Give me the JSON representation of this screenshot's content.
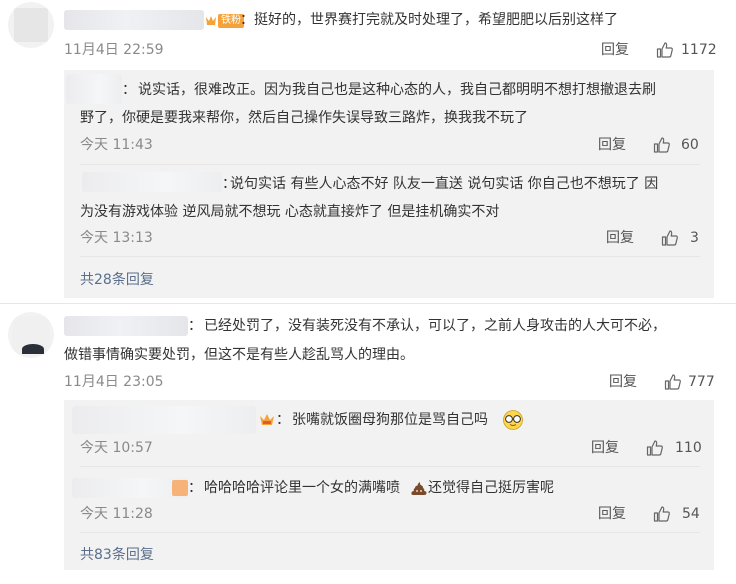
{
  "comments": [
    {
      "id": "c1",
      "sep": "：",
      "badge": "铁粉",
      "text": "挺好的，世界赛打完就及时处理了，希望肥肥以后别这样了",
      "time": "11月4日 22:59",
      "reply": "回复",
      "likes": "1172",
      "replies": [
        {
          "sep": "：",
          "lines": [
            "说实话，很难改正。因为我自己也是这种心态的人，我自己都明明不想打想撤退去刷",
            "野了，你硬是要我来帮你，然后自己操作失误导致三路炸，换我我不玩了"
          ],
          "time": "今天 11:43",
          "reply": "回复",
          "likes": "60"
        },
        {
          "sep": "：",
          "lines": [
            "说句实话 有些人心态不好 队友一直送 说句实话 你自己也不想玩了 因",
            "为没有游戏体验 逆风局就不想玩 心态就直接炸了 但是挂机确实不对"
          ],
          "time": "今天 13:13",
          "reply": "回复",
          "likes": "3"
        }
      ],
      "more": "共28条回复"
    },
    {
      "id": "c2",
      "sep": "：",
      "lines": [
        "已经处罚了，没有装死没有不承认，可以了，之前人身攻击的人大可不必，",
        "做错事情确实要处罚，但这不是有些人趁乱骂人的理由。"
      ],
      "time": "11月4日 23:05",
      "reply": "回复",
      "likes": "777",
      "replies": [
        {
          "sep": "：",
          "text": "张嘴就饭圈母狗那位是骂自己吗",
          "time": "今天 10:57",
          "reply": "回复",
          "likes": "110"
        },
        {
          "sep": "：",
          "text1": "哈哈哈哈评论里一个女的满嘴喷",
          "text2": "还觉得自己挺厉害呢",
          "time": "今天 11:28",
          "reply": "回复",
          "likes": "54"
        }
      ],
      "more": "共83条回复"
    }
  ],
  "icons": {
    "like": "thumbs-up-icon",
    "poop": "poop-emoji-icon",
    "glasses": "glasses-emoji-icon",
    "vip": "vip-badge-icon"
  },
  "colors": {
    "link": "#5a6f8c",
    "badge": "#f5a23a",
    "panel": "#f2f2f2",
    "time": "#8a8a8a"
  }
}
